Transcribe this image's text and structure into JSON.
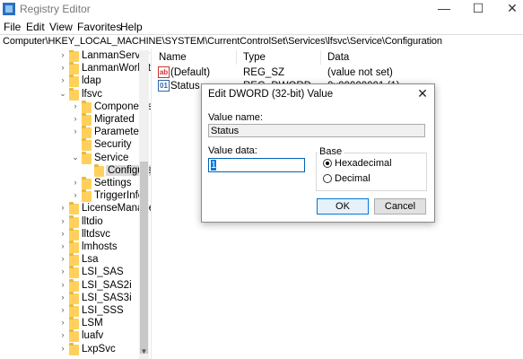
{
  "window": {
    "title": "Registry Editor",
    "minimize": "—",
    "maximize": "☐",
    "close": "✕"
  },
  "menu": [
    "File",
    "Edit",
    "View",
    "Favorites",
    "Help"
  ],
  "address": "Computer\\HKEY_LOCAL_MACHINE\\SYSTEM\\CurrentControlSet\\Services\\lfsvc\\Service\\Configuration",
  "tree": [
    {
      "label": "LanmanServer",
      "expander": "›",
      "level": 0
    },
    {
      "label": "LanmanWorkstation",
      "expander": "›",
      "level": 0
    },
    {
      "label": "ldap",
      "expander": "›",
      "level": 0
    },
    {
      "label": "lfsvc",
      "expander": "⌄",
      "level": 0
    },
    {
      "label": "Components",
      "expander": "›",
      "level": 1
    },
    {
      "label": "Migrated",
      "expander": "›",
      "level": 1
    },
    {
      "label": "Parameters",
      "expander": "›",
      "level": 1
    },
    {
      "label": "Security",
      "expander": "",
      "level": 1
    },
    {
      "label": "Service",
      "expander": "⌄",
      "level": 1
    },
    {
      "label": "Configuration",
      "expander": "",
      "level": 2,
      "selected": true
    },
    {
      "label": "Settings",
      "expander": "›",
      "level": 1
    },
    {
      "label": "TriggerInfo",
      "expander": "›",
      "level": 1
    },
    {
      "label": "LicenseManager",
      "expander": "›",
      "level": 0
    },
    {
      "label": "lltdio",
      "expander": "›",
      "level": 0
    },
    {
      "label": "lltdsvc",
      "expander": "›",
      "level": 0
    },
    {
      "label": "lmhosts",
      "expander": "›",
      "level": 0
    },
    {
      "label": "Lsa",
      "expander": "›",
      "level": 0
    },
    {
      "label": "LSI_SAS",
      "expander": "›",
      "level": 0
    },
    {
      "label": "LSI_SAS2i",
      "expander": "›",
      "level": 0
    },
    {
      "label": "LSI_SAS3i",
      "expander": "›",
      "level": 0
    },
    {
      "label": "LSI_SSS",
      "expander": "›",
      "level": 0
    },
    {
      "label": "LSM",
      "expander": "›",
      "level": 0
    },
    {
      "label": "luafv",
      "expander": "›",
      "level": 0
    },
    {
      "label": "LxpSvc",
      "expander": "›",
      "level": 0
    }
  ],
  "list": {
    "headers": {
      "name": "Name",
      "type": "Type",
      "data": "Data"
    },
    "rows": [
      {
        "icon": "ab",
        "name": "(Default)",
        "type": "REG_SZ",
        "data": "(value not set)"
      },
      {
        "icon": "01",
        "name": "Status",
        "type": "REG_DWORD",
        "data": "0x00000001 (1)"
      }
    ]
  },
  "dialog": {
    "title": "Edit DWORD (32-bit) Value",
    "close": "✕",
    "value_name_label": "Value name:",
    "value_name": "Status",
    "value_data_label": "Value data:",
    "value_data": "1",
    "base_label": "Base",
    "hex_label": "Hexadecimal",
    "dec_label": "Decimal",
    "ok_label": "OK",
    "cancel_label": "Cancel"
  },
  "scroll": {
    "down_arrow": "▼"
  }
}
